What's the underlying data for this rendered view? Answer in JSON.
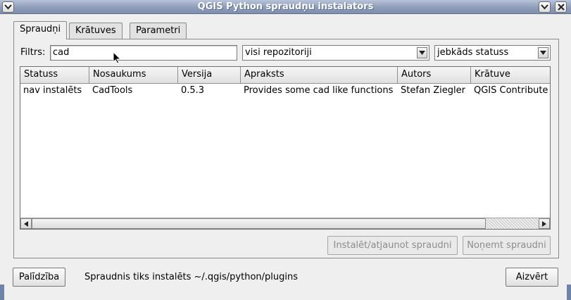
{
  "window": {
    "title": "QGIS Python spraudņu instalators"
  },
  "tabs": [
    {
      "label": "Spraudņi",
      "active": true
    },
    {
      "label": "Krātuves",
      "active": false
    },
    {
      "label": "Parametri",
      "active": false
    }
  ],
  "filter": {
    "label": "Filtrs:",
    "value": "cad",
    "repository_selected": "visi repozitoriji",
    "status_selected": "jebkāds statuss"
  },
  "table": {
    "columns": [
      "Statuss",
      "Nosaukums",
      "Versija",
      "Apraksts",
      "Autors",
      "Krātuve"
    ],
    "rows": [
      [
        "nav instalēts",
        "CadTools",
        "0.5.3",
        "Provides some cad like functions",
        "Stefan Ziegler",
        "QGIS Contribute"
      ]
    ]
  },
  "actions": {
    "install_label": "Instalēt/atjaunot spraudni",
    "remove_label": "Noņemt spraudni"
  },
  "footer": {
    "help_label": "Palīdzība",
    "status_text": "Spraudnis tiks instalēts ~/.qgis/python/plugins",
    "close_label": "Aizvērt"
  }
}
